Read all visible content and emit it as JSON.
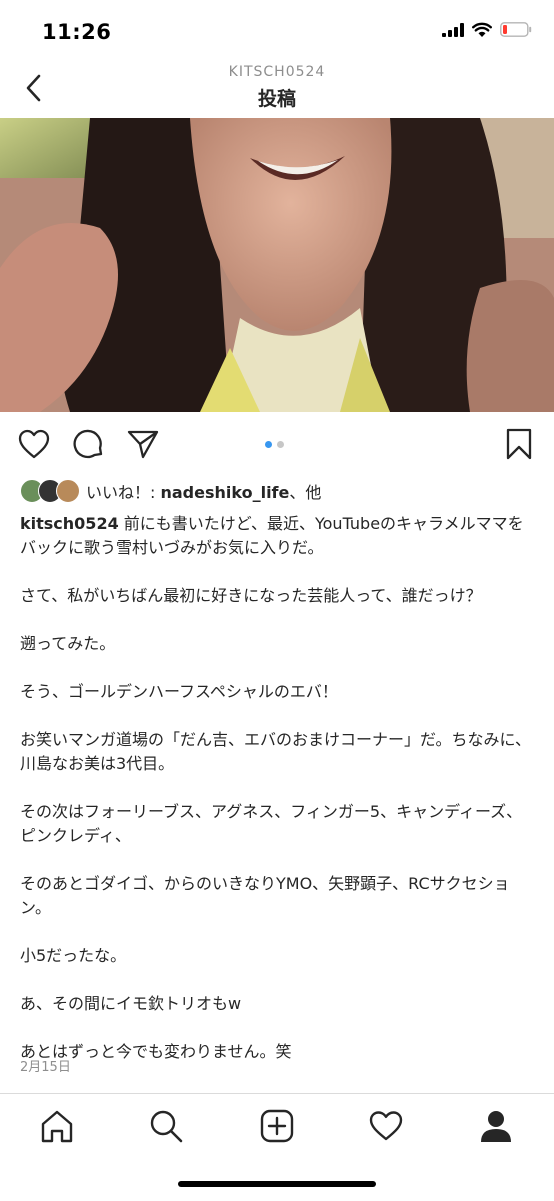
{
  "status_bar": {
    "time": "11:26"
  },
  "header": {
    "username": "KITSCH0524",
    "title": "投稿"
  },
  "carousel": {
    "count": 2,
    "active_index": 0
  },
  "likes": {
    "prefix": "いいね！: ",
    "user": "nadeshiko_life",
    "suffix": "、他"
  },
  "caption": {
    "username": "kitsch0524",
    "text": " 前にも書いたけど、最近、YouTubeのキャラメルママをバックに歌う雪村いづみがお気に入りだ。\n\nさて、私がいちばん最初に好きになった芸能人って、誰だっけ？\n\n遡ってみた。\n\nそう、ゴールデンハーフスペシャルのエバ！\n\nお笑いマンガ道場の「だん吉、エバのおまけコーナー」だ。ちなみに、川島なお美は3代目。\n\nその次はフォーリーブス、アグネス、フィンガー5、キャンディーズ、ピンクレディ、\n\nそのあとゴダイゴ、からのいきなりYMO、矢野顕子、RCサクセション。\n\n小5だったな。\n\nあ、その間にイモ欽トリオもw\n\nあとはずっと今でも変わりません。笑"
  },
  "post_date": "2月15日",
  "colors": {
    "link_blue": "#3897f0",
    "battery_red": "#ff3b30",
    "text": "#262626",
    "muted": "#8e8e8e"
  },
  "icons": {
    "status": [
      "signal-icon",
      "wifi-icon",
      "battery-icon"
    ],
    "actions": [
      "heart-icon",
      "comment-icon",
      "share-icon",
      "bookmark-icon"
    ],
    "tabs": [
      "home-icon",
      "search-icon",
      "add-post-icon",
      "activity-heart-icon",
      "profile-icon"
    ]
  }
}
